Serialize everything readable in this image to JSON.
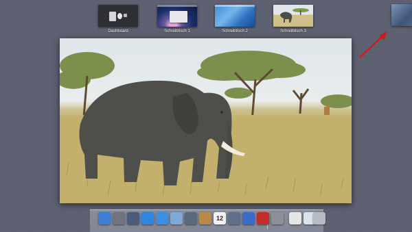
{
  "spaces": [
    {
      "label": "Dashboard"
    },
    {
      "label": "Schreibtisch 1"
    },
    {
      "label": "Schreibtisch 2"
    },
    {
      "label": "Schreibtisch 3"
    }
  ],
  "dock": {
    "items": [
      {
        "icon": "finder-icon",
        "color": "#3f7fd3"
      },
      {
        "icon": "launchpad-icon",
        "color": "#6f7480"
      },
      {
        "icon": "mission-control-icon",
        "color": "#4a5b7f"
      },
      {
        "icon": "app-store-icon",
        "color": "#2f86e0"
      },
      {
        "icon": "safari-icon",
        "color": "#3c8fe2"
      },
      {
        "icon": "mail-icon",
        "color": "#7fa9d9"
      },
      {
        "icon": "facetime-icon",
        "color": "#5a6a7c"
      },
      {
        "icon": "address-book-icon",
        "color": "#b88a4a"
      },
      {
        "icon": "calendar-icon",
        "color": "#f3f3f3",
        "text": "12"
      },
      {
        "icon": "iphoto-icon",
        "color": "#5f6f8c"
      },
      {
        "icon": "itunes-icon",
        "color": "#3c6cc8"
      },
      {
        "icon": "photo-booth-icon",
        "color": "#c42b2b"
      },
      {
        "icon": "system-preferences-icon",
        "color": "#8d9096"
      },
      {
        "icon": "documents-icon",
        "color": "#e6e6e6"
      },
      {
        "icon": "downloads-icon",
        "color": "#d8e3ea"
      },
      {
        "icon": "trash-icon",
        "color": "#b7bcc4"
      }
    ]
  },
  "colors": {
    "background": "#5c6070",
    "arrow": "#d11a1a"
  }
}
